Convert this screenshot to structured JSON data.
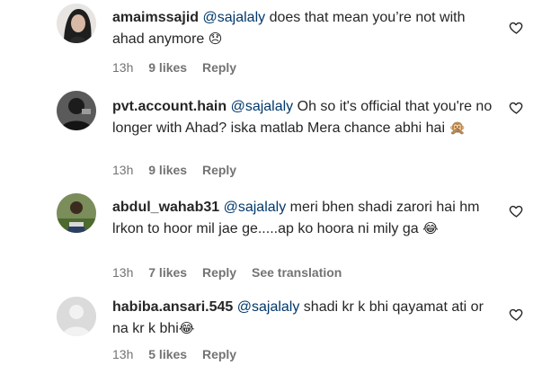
{
  "comments": [
    {
      "username": "amaimssajid",
      "mention": "@sajalaly",
      "text": " does that mean you’re not with ahad anymore ",
      "emoji": "😞",
      "time": "13h",
      "likes": "9 likes",
      "reply": "Reply",
      "avatar_color": "#2b2b2b"
    },
    {
      "username": "pvt.account.hain",
      "mention": "@sajalaly",
      "text": " Oh so it's official that you're no longer with Ahad? iska matlab Mera chance abhi hai ",
      "emoji": "🙊",
      "time": "13h",
      "likes": "9 likes",
      "reply": "Reply",
      "avatar_color": "#3a3a3a"
    },
    {
      "username": "abdul_wahab31",
      "mention": "@sajalaly",
      "text": " meri bhen shadi zarori hai hm lrkon to hoor mil jae ge.....ap ko hoora ni mily ga ",
      "emoji": "😂",
      "time": "13h",
      "likes": "7 likes",
      "reply": "Reply",
      "translation": "See translation",
      "avatar_color": "#4f6b3c"
    },
    {
      "username": "habiba.ansari.545",
      "mention": "@sajalaly",
      "text": " shadi kr k bhi qayamat ati or na kr k bhi",
      "emoji": "😂",
      "time": "13h",
      "likes": "5 likes",
      "reply": "Reply",
      "avatar_color": "#dbdbdb"
    }
  ],
  "colors": {
    "mention": "#00376b",
    "meta": "#737373",
    "text": "#262626"
  },
  "icons": {
    "like": "heart-outline-icon"
  }
}
